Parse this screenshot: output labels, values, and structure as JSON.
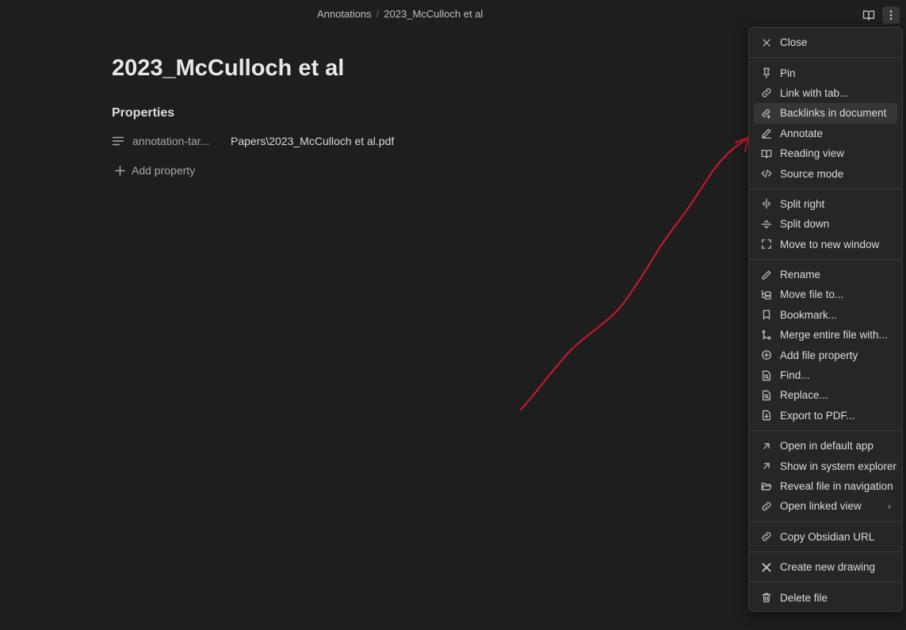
{
  "breadcrumb": {
    "folder": "Annotations",
    "separator": "/",
    "file": "2023_McCulloch et al"
  },
  "note": {
    "title": "2023_McCulloch et al",
    "properties_heading": "Properties",
    "property": {
      "key": "annotation-tar...",
      "value": "Papers\\2023_McCulloch et al.pdf"
    },
    "add_property": "Add property"
  },
  "menu": {
    "close": "Close",
    "pin": "Pin",
    "link_with_tab": "Link with tab...",
    "backlinks": "Backlinks in document",
    "annotate": "Annotate",
    "reading_view": "Reading view",
    "source_mode": "Source mode",
    "split_right": "Split right",
    "split_down": "Split down",
    "move_new_window": "Move to new window",
    "rename": "Rename",
    "move_file": "Move file to...",
    "bookmark": "Bookmark...",
    "merge": "Merge entire file with...",
    "add_file_property": "Add file property",
    "find": "Find...",
    "replace": "Replace...",
    "export_pdf": "Export to PDF...",
    "open_default": "Open in default app",
    "show_explorer": "Show in system explorer",
    "reveal_nav": "Reveal file in navigation",
    "open_linked": "Open linked view",
    "copy_url": "Copy Obsidian URL",
    "new_drawing": "Create new drawing",
    "delete_file": "Delete file"
  },
  "colors": {
    "background": "#1e1e1e",
    "menu_bg": "#262626",
    "annotation_arrow": "#d0172c"
  }
}
